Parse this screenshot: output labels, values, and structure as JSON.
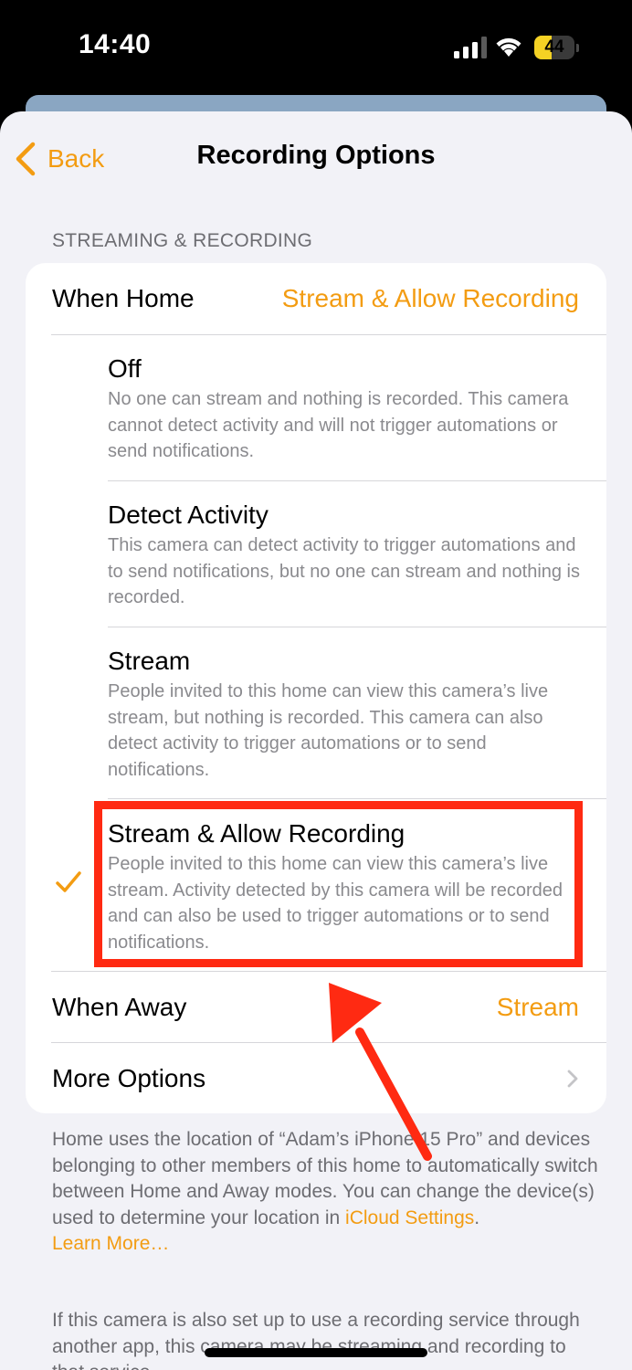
{
  "status": {
    "time": "14:40",
    "battery": "44",
    "battery_level": 0.44
  },
  "nav": {
    "back_label": "Back",
    "title": "Recording Options"
  },
  "section_header": "STREAMING & RECORDING",
  "when_home": {
    "label": "When Home",
    "value": "Stream & Allow Recording"
  },
  "options": [
    {
      "title": "Off",
      "description": "No one can stream and nothing is recorded. This camera cannot detect activity and will not trigger automations or send notifications."
    },
    {
      "title": "Detect Activity",
      "description": "This camera can detect activity to trigger automations and to send notifications, but no one can stream and nothing is recorded."
    },
    {
      "title": "Stream",
      "description": "People invited to this home can view this camera’s live stream, but nothing is recorded. This camera can also detect activity to trigger automations or to send notifications."
    },
    {
      "title": "Stream & Allow Recording",
      "description": "People invited to this home can view this camera’s live stream. Activity detected by this camera will be recorded and can also be used to trigger automations or to send notifications.",
      "selected": true
    }
  ],
  "when_away": {
    "label": "When Away",
    "value": "Stream"
  },
  "more_options": {
    "label": "More Options"
  },
  "footer": {
    "text": "Home uses the location of “Adam’s iPhone 15 Pro” and devices belonging to other members of this home to automatically switch between Home and Away modes. You can change the device(s) used to determine your location in ",
    "link": "iCloud Settings",
    "text_end": ".",
    "learn_more": "Learn More…",
    "note": "If this camera is also set up to use a recording service through another app, this camera may be streaming and recording to that service."
  },
  "colors": {
    "accent": "#f39c12",
    "annotation": "#ff2a12"
  },
  "icons": {
    "back": "chevron-left-icon",
    "selected": "checkmark-icon",
    "disclosure": "chevron-right-icon"
  }
}
